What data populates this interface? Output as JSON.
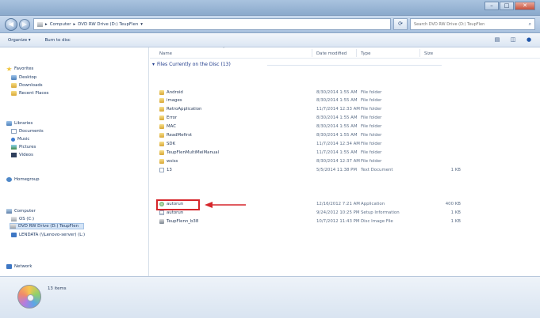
{
  "address": {
    "crumbs": [
      "Computer",
      "DVD RW Drive (D:) TeupFlen"
    ],
    "refresh_icon": "refresh-icon",
    "search_placeholder": "Search DVD RW Drive (D:) TeupFlen"
  },
  "toolbar": {
    "organize_label": "Organize ▾",
    "burn_label": "Burn to disc"
  },
  "nav": {
    "favorites": "Favorites",
    "desktop": "Desktop",
    "downloads": "Downloads",
    "recent": "Recent Places",
    "libraries": "Libraries",
    "documents": "Documents",
    "music": "Music",
    "pictures": "Pictures",
    "videos": "Videos",
    "homegroup": "Homegroup",
    "computer": "Computer",
    "os_drive": "OS (C:)",
    "dvd_drive": "DVD RW Drive (D:) TeupFlen",
    "lenovo_drive": "LENDATA (\\\\Lenovo-server) (L:)",
    "network": "Network"
  },
  "columns": {
    "name": "Name",
    "date": "Date modified",
    "type": "Type",
    "size": "Size"
  },
  "group": {
    "label": "Files Currently on the Disc (13)"
  },
  "files": [
    {
      "name": "Android",
      "date": "8/30/2014 1:55 AM",
      "type": "File folder",
      "size": "",
      "icon": "folder"
    },
    {
      "name": "images",
      "date": "8/30/2014 1:55 AM",
      "type": "File folder",
      "size": "",
      "icon": "folder"
    },
    {
      "name": "RetroApplication",
      "date": "11/7/2014 12:33 AM",
      "type": "File folder",
      "size": "",
      "icon": "folder"
    },
    {
      "name": "Error",
      "date": "8/30/2014 1:55 AM",
      "type": "File folder",
      "size": "",
      "icon": "folder"
    },
    {
      "name": "MAC",
      "date": "8/30/2014 1:55 AM",
      "type": "File folder",
      "size": "",
      "icon": "folder"
    },
    {
      "name": "ReadMefirst",
      "date": "8/30/2014 1:55 AM",
      "type": "File folder",
      "size": "",
      "icon": "folder"
    },
    {
      "name": "SDK",
      "date": "11/7/2014 12:34 AM",
      "type": "File folder",
      "size": "",
      "icon": "folder"
    },
    {
      "name": "TeupFlenMultiMeiManual",
      "date": "11/7/2014 1:55 AM",
      "type": "File folder",
      "size": "",
      "icon": "folder"
    },
    {
      "name": "wsiss",
      "date": "8/30/2014 12:37 AM",
      "type": "File folder",
      "size": "",
      "icon": "folder"
    },
    {
      "name": "13",
      "date": "5/5/2014 11:38 PM",
      "type": "Text Document",
      "size": "1 KB",
      "icon": "txt"
    },
    {
      "name": "autorun",
      "date": "12/16/2012 7:21 AM",
      "type": "Application",
      "size": "400 KB",
      "icon": "app"
    },
    {
      "name": "autorun",
      "date": "9/24/2012 10:25 PM",
      "type": "Setup Information",
      "size": "1 KB",
      "icon": "inf"
    },
    {
      "name": "TeupFlenn_b38",
      "date": "10/7/2012 11:43 PM",
      "type": "Disc Image File",
      "size": "1 KB",
      "icon": "iso"
    }
  ],
  "status": {
    "item_count": "13 items"
  },
  "colors": {
    "highlight": "#d6262b",
    "chrome": "#a9c3df"
  }
}
